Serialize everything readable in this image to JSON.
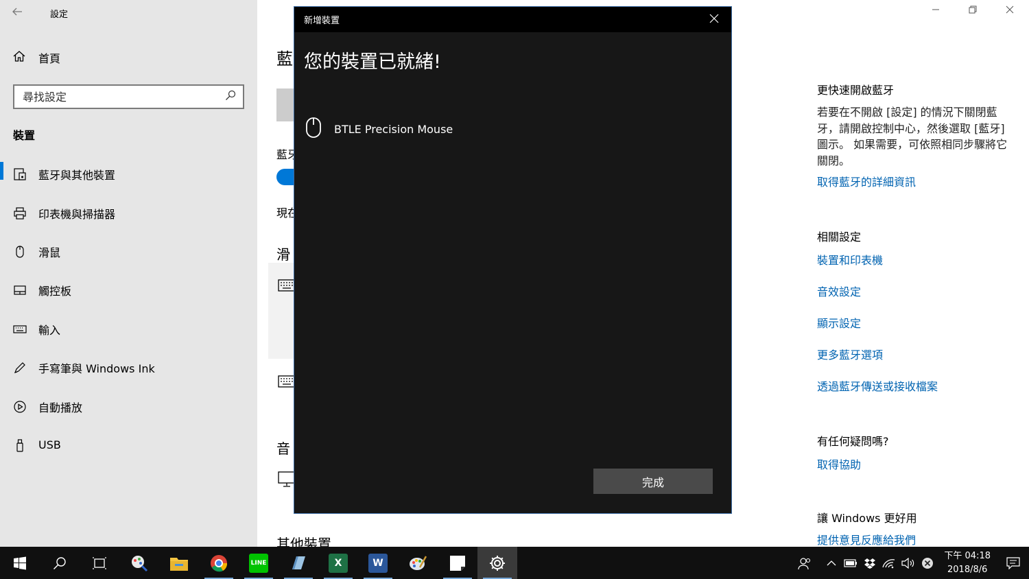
{
  "window": {
    "app_title": "設定"
  },
  "sidebar": {
    "home_label": "首頁",
    "search_placeholder": "尋找設定",
    "section_title": "裝置",
    "items": [
      {
        "label": "藍牙與其他裝置",
        "icon": "bluetooth-devices-icon"
      },
      {
        "label": "印表機與掃描器",
        "icon": "printer-icon"
      },
      {
        "label": "滑鼠",
        "icon": "mouse-icon"
      },
      {
        "label": "觸控板",
        "icon": "touchpad-icon"
      },
      {
        "label": "輸入",
        "icon": "keyboard-icon"
      },
      {
        "label": "手寫筆與 Windows Ink",
        "icon": "pen-icon"
      },
      {
        "label": "自動播放",
        "icon": "autoplay-icon"
      },
      {
        "label": "USB",
        "icon": "usb-icon"
      }
    ]
  },
  "main": {
    "partial_title": "藍",
    "partial_bt": "藍牙",
    "partial_now": "現在",
    "partial_mouse_section": "滑",
    "partial_audio_section": "音",
    "other_devices": "其他裝置"
  },
  "right_column": {
    "quick_heading": "更快速開啟藍牙",
    "quick_text": "若要在不開啟 [設定] 的情況下關閉藍牙，請開啟控制中心，然後選取 [藍牙] 圖示。 如果需要，可依照相同步驟將它關閉。",
    "quick_link": "取得藍牙的詳細資訊",
    "related_heading": "相關設定",
    "related_links": [
      "裝置和印表機",
      "音效設定",
      "顯示設定",
      "更多藍牙選項",
      "透過藍牙傳送或接收檔案"
    ],
    "help_heading": "有任何疑問嗎?",
    "help_link": "取得協助",
    "improve_heading": "讓 Windows 更好用",
    "improve_link": "提供意見反應給我們"
  },
  "dialog": {
    "title": "新增裝置",
    "heading": "您的裝置已就緒!",
    "device_name": "BTLE Precision Mouse",
    "done_label": "完成"
  },
  "taskbar": {
    "time": "下午 04:18",
    "date": "2018/8/6"
  },
  "colors": {
    "accent": "#0078d7",
    "link": "#0063b1",
    "dialog_bg": "#171717",
    "taskbar_bg": "#101010"
  }
}
